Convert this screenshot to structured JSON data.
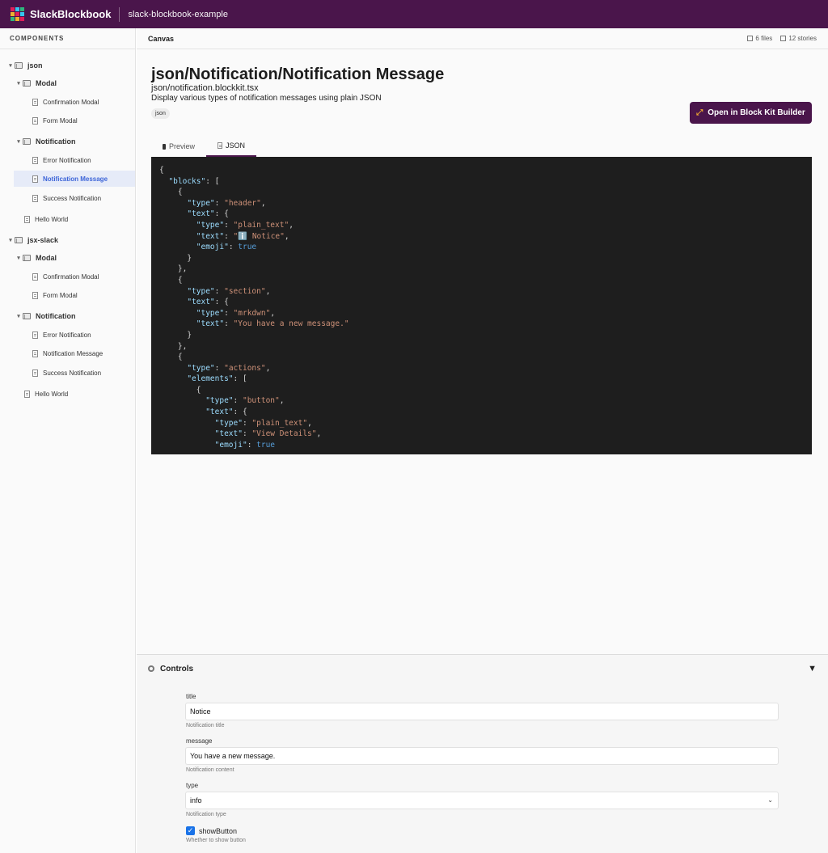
{
  "app": {
    "brand": "SlackBlockbook",
    "project": "slack-blockbook-example",
    "logo_colors": [
      "#e01e5a",
      "#36c5f0",
      "#2eb67d",
      "#ecb22e",
      "#e01e5a",
      "#36c5f0",
      "#2eb67d",
      "#ecb22e",
      "#e01e5a"
    ]
  },
  "sidebar": {
    "heading": "COMPONENTS",
    "tree": [
      {
        "label": "json",
        "kind": "root"
      },
      {
        "label": "Modal",
        "kind": "folder"
      },
      {
        "label": "Confirmation Modal",
        "kind": "story"
      },
      {
        "label": "Form Modal",
        "kind": "story"
      },
      {
        "label": "Notification",
        "kind": "folder"
      },
      {
        "label": "Error Notification",
        "kind": "story"
      },
      {
        "label": "Notification Message",
        "kind": "story",
        "active": true
      },
      {
        "label": "Success Notification",
        "kind": "story"
      },
      {
        "label": "Hello World",
        "kind": "story-top"
      },
      {
        "label": "jsx-slack",
        "kind": "root"
      },
      {
        "label": "Modal",
        "kind": "folder"
      },
      {
        "label": "Confirmation Modal",
        "kind": "story"
      },
      {
        "label": "Form Modal",
        "kind": "story"
      },
      {
        "label": "Notification",
        "kind": "folder"
      },
      {
        "label": "Error Notification",
        "kind": "story"
      },
      {
        "label": "Notification Message",
        "kind": "story"
      },
      {
        "label": "Success Notification",
        "kind": "story"
      },
      {
        "label": "Hello World",
        "kind": "story-top"
      }
    ]
  },
  "canvas": {
    "title": "Canvas",
    "files": "6 files",
    "stories": "12 stories"
  },
  "story": {
    "title": "json/Notification/Notification Message",
    "file": "json/notification.blockkit.tsx",
    "description": "Display various types of notification messages using plain JSON",
    "tag": "json",
    "open_button": "Open in Block Kit Builder"
  },
  "tabs": [
    {
      "label": "Preview",
      "icon": "phone-icon"
    },
    {
      "label": "JSON",
      "icon": "file-icon",
      "active": true
    }
  ],
  "code_lines": [
    "{",
    "  \"blocks\": [",
    "    {",
    "      \"type\": \"header\",",
    "      \"text\": {",
    "        \"type\": \"plain_text\",",
    "        \"text\": \"ℹ️ Notice\",",
    "        \"emoji\": true",
    "      }",
    "    },",
    "    {",
    "      \"type\": \"section\",",
    "      \"text\": {",
    "        \"type\": \"mrkdwn\",",
    "        \"text\": \"You have a new message.\"",
    "      }",
    "    },",
    "    {",
    "      \"type\": \"actions\",",
    "      \"elements\": [",
    "        {",
    "          \"type\": \"button\",",
    "          \"text\": {",
    "            \"type\": \"plain_text\",",
    "            \"text\": \"View Details\",",
    "            \"emoji\": true"
  ],
  "controls": {
    "title": "Controls",
    "collapse_icon": "▼",
    "fields": {
      "title": {
        "label": "title",
        "value": "Notice",
        "help": "Notification title"
      },
      "message": {
        "label": "message",
        "value": "You have a new message.",
        "help": "Notification content"
      },
      "type": {
        "label": "type",
        "value": "info",
        "help": "Notification type"
      },
      "showButton": {
        "label": "showButton",
        "checked": true,
        "help": "Whether to show button"
      }
    }
  }
}
